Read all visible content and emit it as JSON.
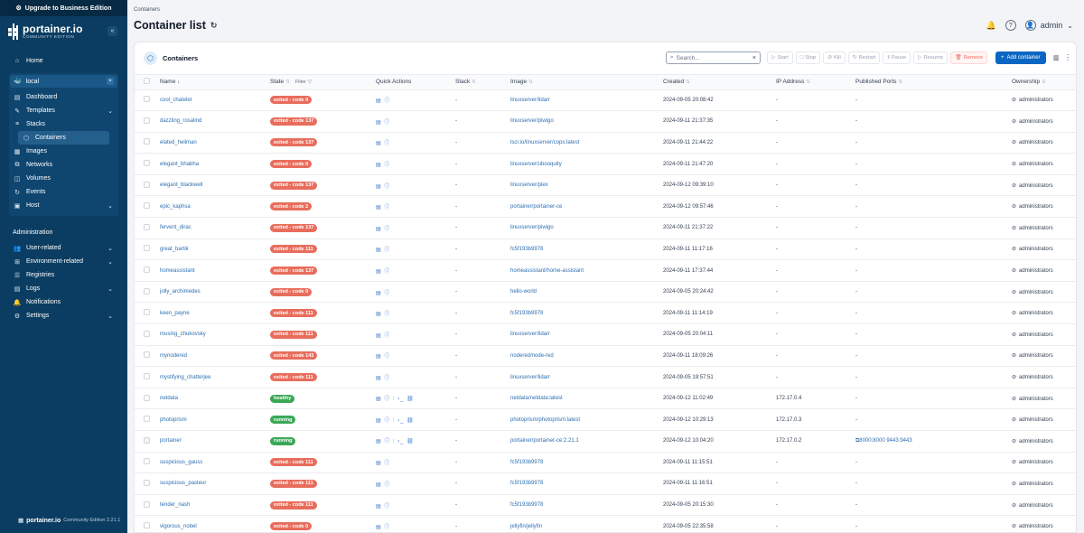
{
  "upgrade_label": "Upgrade to Business Edition",
  "logo": {
    "name": "portainer.io",
    "sub": "COMMUNITY EDITION"
  },
  "nav": {
    "home": "Home",
    "environment": "local",
    "env_items": [
      "Dashboard",
      "Templates",
      "Stacks",
      "Containers",
      "Images",
      "Networks",
      "Volumes",
      "Events",
      "Host"
    ],
    "admin_title": "Administration",
    "admin_items": [
      "User-related",
      "Environment-related",
      "Registries",
      "Logs",
      "Notifications",
      "Settings"
    ]
  },
  "footer": {
    "brand": "portainer.io",
    "edition": "Community Edition 2.21.1"
  },
  "header": {
    "breadcrumb": "Containers",
    "title": "Container list",
    "user": "admin"
  },
  "panel": {
    "title": "Containers",
    "search_placeholder": "Search...",
    "actions": [
      "Start",
      "Stop",
      "Kill",
      "Restart",
      "Pause",
      "Resume",
      "Remove"
    ],
    "add_label": "Add container"
  },
  "columns": [
    "Name",
    "State",
    "Quick Actions",
    "Stack",
    "Image",
    "Created",
    "IP Address",
    "Published Ports",
    "Ownership"
  ],
  "filter_label": "Filter",
  "rows": [
    {
      "name": "cool_chatelet",
      "state": "exited - code 0",
      "ok": false,
      "stack": "-",
      "image": "linuxserver/lidarr",
      "created": "2024-09-05 20:08:42",
      "ip": "-",
      "ports": "-",
      "owner": "administrators"
    },
    {
      "name": "dazzling_rosalind",
      "state": "exited - code 137",
      "ok": false,
      "stack": "-",
      "image": "linuxserver/piwigo",
      "created": "2024-09-11 21:37:35",
      "ip": "-",
      "ports": "-",
      "owner": "administrators"
    },
    {
      "name": "elated_heliman",
      "state": "exited - code 137",
      "ok": false,
      "stack": "-",
      "image": "lscr.io/linuxserver/cops:latest",
      "created": "2024-09-11 21:44:22",
      "ip": "-",
      "ports": "-",
      "owner": "administrators"
    },
    {
      "name": "elegant_bhabha",
      "state": "exited - code 0",
      "ok": false,
      "stack": "-",
      "image": "linuxserver/ubooquity",
      "created": "2024-09-11 21:47:20",
      "ip": "-",
      "ports": "-",
      "owner": "administrators"
    },
    {
      "name": "elegant_blackwell",
      "state": "exited - code 137",
      "ok": false,
      "stack": "-",
      "image": "linuxserver/plex",
      "created": "2024-09-12 09:39:10",
      "ip": "-",
      "ports": "-",
      "owner": "administrators"
    },
    {
      "name": "epic_kaphsa",
      "state": "exited - code 2",
      "ok": false,
      "stack": "-",
      "image": "portainer/portainer-ce",
      "created": "2024-09-12 09:57:46",
      "ip": "-",
      "ports": "-",
      "owner": "administrators"
    },
    {
      "name": "fervent_dirac",
      "state": "exited - code 137",
      "ok": false,
      "stack": "-",
      "image": "linuxserver/piwigo",
      "created": "2024-09-11 21:37:22",
      "ip": "-",
      "ports": "-",
      "owner": "administrators"
    },
    {
      "name": "great_bartik",
      "state": "exited - code 111",
      "ok": false,
      "stack": "-",
      "image": "fc5f193b9978",
      "created": "2024-09-11 11:17:16",
      "ip": "-",
      "ports": "-",
      "owner": "administrators"
    },
    {
      "name": "homeassistant",
      "state": "exited - code 137",
      "ok": false,
      "stack": "-",
      "image": "homeassistant/home-assistant",
      "created": "2024-09-11 17:37:44",
      "ip": "-",
      "ports": "-",
      "owner": "administrators"
    },
    {
      "name": "jolly_archimedes",
      "state": "exited - code 0",
      "ok": false,
      "stack": "-",
      "image": "hello-world",
      "created": "2024-09-05 20:24:42",
      "ip": "-",
      "ports": "-",
      "owner": "administrators"
    },
    {
      "name": "keen_payne",
      "state": "exited - code 111",
      "ok": false,
      "stack": "-",
      "image": "fc5f193b9978",
      "created": "2024-09-11 11:14:19",
      "ip": "-",
      "ports": "-",
      "owner": "administrators"
    },
    {
      "name": "musing_zhukovsky",
      "state": "exited - code 111",
      "ok": false,
      "stack": "-",
      "image": "linuxserver/lidarr",
      "created": "2024-09-05 20:04:11",
      "ip": "-",
      "ports": "-",
      "owner": "administrators"
    },
    {
      "name": "mynodered",
      "state": "exited - code 143",
      "ok": false,
      "stack": "-",
      "image": "nodered/node-red",
      "created": "2024-09-11 18:09:26",
      "ip": "-",
      "ports": "-",
      "owner": "administrators"
    },
    {
      "name": "mystifying_chatterjee",
      "state": "exited - code 111",
      "ok": false,
      "stack": "-",
      "image": "linuxserver/lidarr",
      "created": "2024-09-05 19:57:51",
      "ip": "-",
      "ports": "-",
      "owner": "administrators"
    },
    {
      "name": "netdata",
      "state": "healthy",
      "ok": true,
      "stack": "-",
      "image": "netdata/netdata:latest",
      "created": "2024-09-12 11:02:49",
      "ip": "172.17.0.4",
      "ports": "-",
      "owner": "administrators"
    },
    {
      "name": "photoprism",
      "state": "running",
      "ok": true,
      "stack": "-",
      "image": "photoprism/photoprism:latest",
      "created": "2024-09-12 10:29:13",
      "ip": "172.17.0.3",
      "ports": "-",
      "owner": "administrators"
    },
    {
      "name": "portainer",
      "state": "running",
      "ok": true,
      "stack": "-",
      "image": "portainer/portainer-ce:2.21.1",
      "created": "2024-09-12 10:04:20",
      "ip": "172.17.0.2",
      "ports": "8000:8000 9443:9443",
      "owner": "administrators"
    },
    {
      "name": "suspicious_gauss",
      "state": "exited - code 111",
      "ok": false,
      "stack": "-",
      "image": "fc5f193b9978",
      "created": "2024-09-11 11:15:51",
      "ip": "-",
      "ports": "-",
      "owner": "administrators"
    },
    {
      "name": "suspicious_pasteur",
      "state": "exited - code 111",
      "ok": false,
      "stack": "-",
      "image": "fc5f193b9978",
      "created": "2024-09-11 11:16:51",
      "ip": "-",
      "ports": "-",
      "owner": "administrators"
    },
    {
      "name": "tender_nash",
      "state": "exited - code 111",
      "ok": false,
      "stack": "-",
      "image": "fc5f193b9978",
      "created": "2024-09-05 20:15:30",
      "ip": "-",
      "ports": "-",
      "owner": "administrators"
    },
    {
      "name": "vigorous_nobel",
      "state": "exited - code 0",
      "ok": false,
      "stack": "-",
      "image": "jellyfin/jellyfin",
      "created": "2024-09-05 22:35:58",
      "ip": "-",
      "ports": "-",
      "owner": "administrators"
    }
  ]
}
